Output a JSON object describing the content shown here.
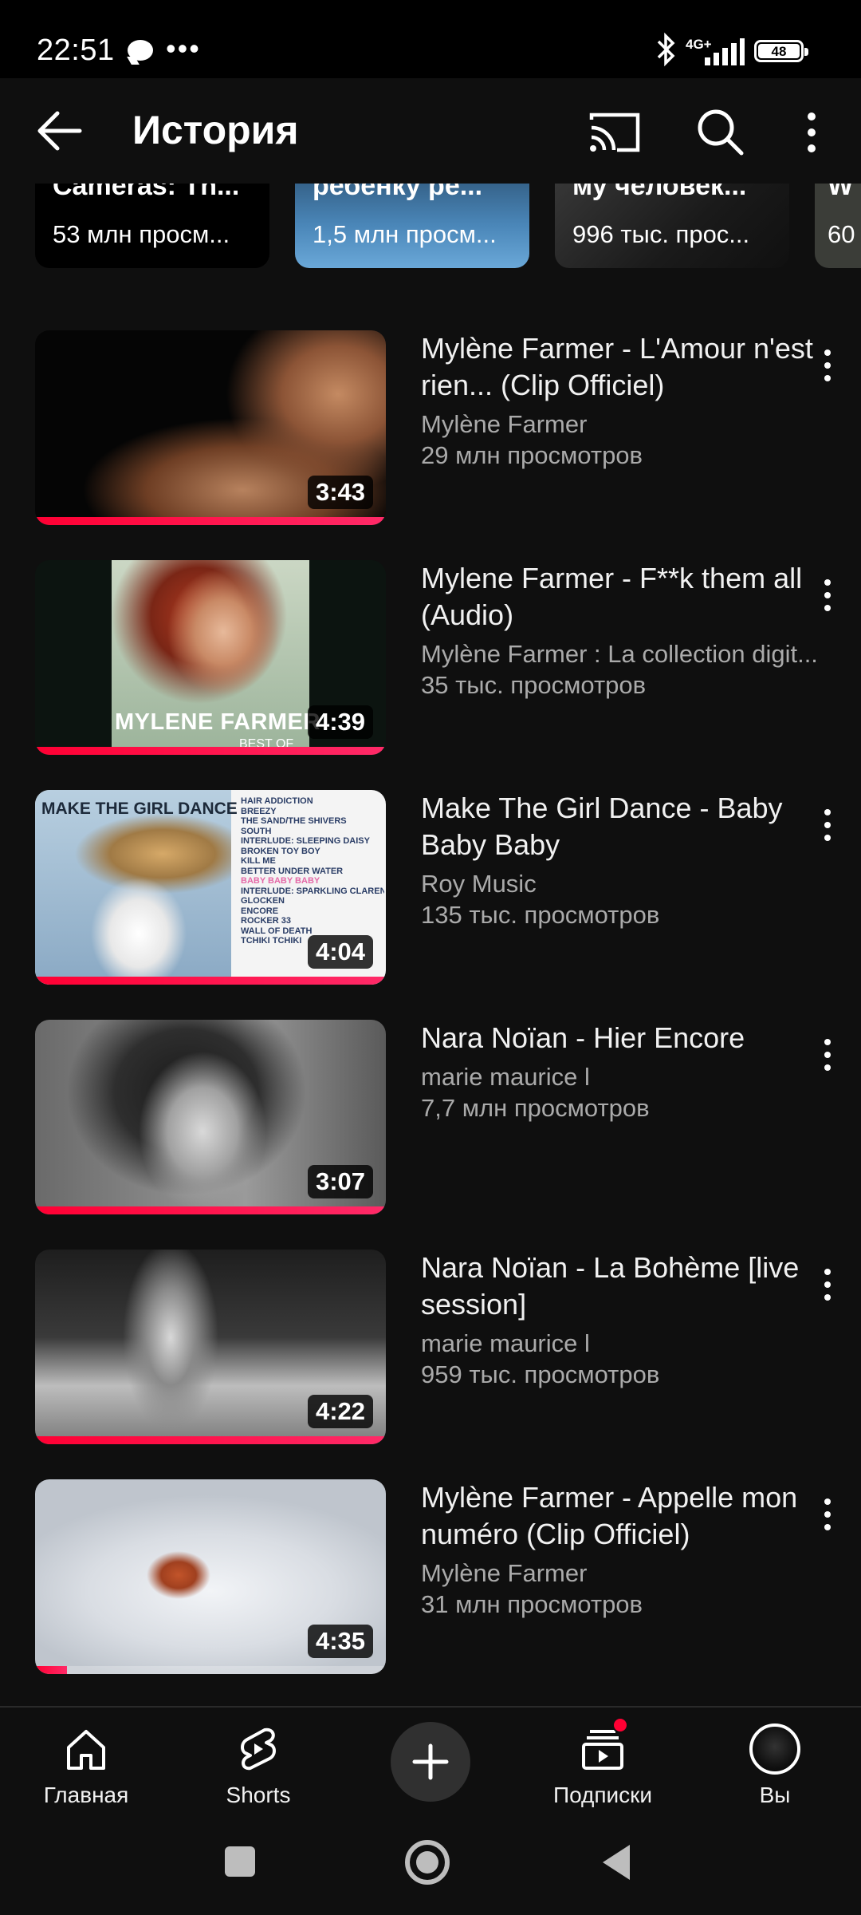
{
  "status_bar": {
    "time": "22:51",
    "network": "4G+",
    "battery": "48"
  },
  "app_bar": {
    "title": "История",
    "icons": [
      "back-arrow-icon",
      "cast-icon",
      "search-icon",
      "more-vert-icon"
    ]
  },
  "shorts": [
    {
      "title": "Cameras: Th...",
      "views": "53 млн просм..."
    },
    {
      "title": "ребенку ре...",
      "views": "1,5 млн просм..."
    },
    {
      "title": "му человек...",
      "views": "996 тыс. прос..."
    },
    {
      "title": "W",
      "views": "60"
    }
  ],
  "videos": [
    {
      "title": "Mylène Farmer - L'Amour n'est rien... (Clip Officiel)",
      "channel": "Mylène Farmer",
      "views": "29 млн просмотров",
      "duration": "3:43",
      "progress": 1.0
    },
    {
      "title": "Mylene Farmer - F**k them all (Audio)",
      "channel": "Mylène Farmer : La collection digit...",
      "views": "35 тыс. просмотров",
      "duration": "4:39",
      "progress": 1.0,
      "thumb_text": [
        "MYLENE FARMER",
        "BEST OF"
      ]
    },
    {
      "title": "Make The Girl Dance - Baby Baby Baby",
      "channel": "Roy Music",
      "views": "135 тыс. просмотров",
      "duration": "4:04",
      "progress": 1.0,
      "thumb_text": [
        "MAKE THE GIRL DANCE",
        "HAIR ADDICTION",
        "BREEZY",
        "THE SAND/THE SHIVERS",
        "SOUTH",
        "INTERLUDE: SLEEPING DAISY",
        "BROKEN TOY BOY",
        "KILL ME",
        "BETTER UNDER WATER",
        "BABY BABY BABY",
        "INTERLUDE: SPARKLING CLARENCE",
        "GLOCKEN",
        "ENCORE",
        "ROCKER 33",
        "WALL OF DEATH",
        "TCHIKI TCHIKI"
      ]
    },
    {
      "title": "Nara Noïan - Hier Encore",
      "channel": "marie maurice l",
      "views": "7,7 млн просмотров",
      "duration": "3:07",
      "progress": 1.0
    },
    {
      "title": "Nara Noïan - La Bohème [live session]",
      "channel": "marie maurice l",
      "views": "959 тыс. просмотров",
      "duration": "4:22",
      "progress": 1.0
    },
    {
      "title": "Mylène Farmer - Appelle mon numéro  (Clip Officiel)",
      "channel": "Mylène Farmer",
      "views": "31 млн просмотров",
      "duration": "4:35",
      "progress": 0.09
    }
  ],
  "bottom_nav": {
    "home": "Главная",
    "shorts": "Shorts",
    "subscriptions": "Подписки",
    "you": "Вы"
  },
  "colors": {
    "background": "#0f0f0f",
    "progress": "#ff0033",
    "secondary_text": "#aaaaaa"
  }
}
